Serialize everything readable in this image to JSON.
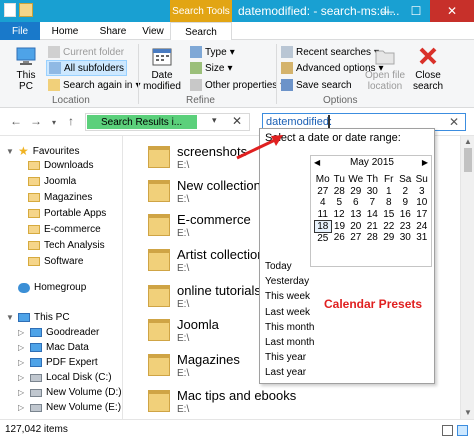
{
  "titlebar": {
    "context_tab": "Search Tools",
    "title": "datemodified: - search-ms:di..."
  },
  "tabs": [
    {
      "label": "File"
    },
    {
      "label": "Home"
    },
    {
      "label": "Share"
    },
    {
      "label": "View"
    },
    {
      "label": "Search"
    }
  ],
  "ribbon": {
    "location": {
      "this_pc": "This\nPC",
      "current_folder": "Current folder",
      "all_subfolders": "All subfolders",
      "search_again": "Search again in",
      "label": "Location"
    },
    "refine": {
      "date_modified": "Date\nmodified",
      "kind": "Type",
      "size": "Size",
      "other_properties": "Other properties",
      "label": "Refine"
    },
    "options": {
      "recent_searches": "Recent searches",
      "advanced_options": "Advanced options",
      "save_search": "Save search",
      "open_file_location": "Open file\nlocation",
      "close_search": "Close\nsearch",
      "label": "Options"
    }
  },
  "address": {
    "breadcrumb": "Search Results i...",
    "search_query": "datemodified:"
  },
  "navpane": {
    "favourites": "Favourites",
    "favourite_items": [
      "Downloads",
      "Joomla",
      "Magazines",
      "Portable Apps",
      "E-commerce",
      "Tech Analysis",
      "Software"
    ],
    "homegroup": "Homegroup",
    "this_pc": "This PC",
    "pc_items": [
      "Goodreader",
      "Mac Data",
      "PDF Expert",
      "Local Disk (C:)",
      "New Volume (D:)",
      "New Volume (E:)"
    ]
  },
  "files": [
    {
      "name": "screenshots",
      "path": "E:\\"
    },
    {
      "name": "New collection o",
      "path": "E:\\"
    },
    {
      "name": "E-commerce",
      "path": "E:\\"
    },
    {
      "name": "Artist collection",
      "path": "E:\\"
    },
    {
      "name": "online tutorials",
      "path": "E:\\"
    },
    {
      "name": "Joomla",
      "path": "E:\\"
    },
    {
      "name": "Magazines",
      "path": "E:\\"
    },
    {
      "name": "Mac tips and ebooks",
      "path": "E:\\"
    }
  ],
  "datepicker": {
    "header": "Select a date or date range:",
    "month": "May 2015",
    "weekdays": [
      "Mo",
      "Tu",
      "We",
      "Th",
      "Fr",
      "Sa",
      "Su"
    ],
    "weeks": [
      [
        "27",
        "28",
        "29",
        "30",
        "1",
        "2",
        "3"
      ],
      [
        "4",
        "5",
        "6",
        "7",
        "8",
        "9",
        "10"
      ],
      [
        "11",
        "12",
        "13",
        "14",
        "15",
        "16",
        "17"
      ],
      [
        "18",
        "19",
        "20",
        "21",
        "22",
        "23",
        "24"
      ],
      [
        "25",
        "26",
        "27",
        "28",
        "29",
        "30",
        "31"
      ]
    ],
    "today": "18",
    "presets": [
      "Today",
      "Yesterday",
      "This week",
      "Last week",
      "This month",
      "Last month",
      "This year",
      "Last year"
    ]
  },
  "callout": "Calendar Presets",
  "status": {
    "count": "127,042 items"
  },
  "colors": {
    "titlebar": "#19a0d2",
    "search_tools": "#e2a514",
    "file_tab": "#1979ca",
    "callout": "#e02020"
  }
}
